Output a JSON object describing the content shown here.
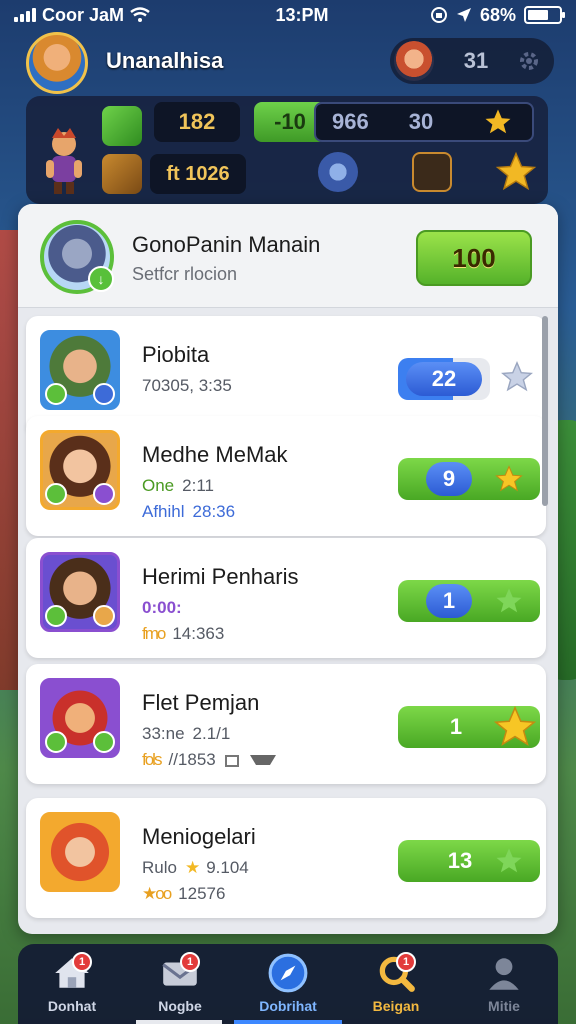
{
  "status_bar": {
    "carrier": "Coor JaM",
    "time": "13:PM",
    "battery": "68%",
    "battery_level": 0.68
  },
  "header": {
    "username": "Unanalhisa",
    "pill_value": "31"
  },
  "resources": {
    "r1": "182",
    "r2": "-10",
    "r3": "966",
    "r4": "30",
    "r5": "ft 1026"
  },
  "feature": {
    "title": "GonoPanin Manain",
    "subtitle": "Setfcr rlocion",
    "button_label": "100"
  },
  "items": [
    {
      "name": "Piobita",
      "line1": "70305, 3:35",
      "line2": "",
      "badge": "22",
      "star_style": "outline"
    },
    {
      "name": "Medhe MeMak",
      "line1_prefix": "One",
      "line1": "2:11",
      "line2_prefix": "Afhihl",
      "line2": "28:36",
      "badge": "9",
      "star_style": "gold"
    },
    {
      "name": "Herimi Penharis",
      "line1": "0:00:",
      "line2_prefix": "fmo",
      "line2": "14:363",
      "badge": "1",
      "star_style": "green"
    },
    {
      "name": "Flet Pemjan",
      "line1_prefix": "33:ne",
      "line1": "2.1/1",
      "line2_prefix": "fols",
      "line2": "//1853",
      "badge": "1",
      "star_style": "gold"
    },
    {
      "name": "Meniogelari",
      "line1_prefix": "Rulo",
      "line1": "9.104",
      "line2_prefix": "★oo",
      "line2": "12576",
      "badge": "13",
      "star_style": "green"
    }
  ],
  "nav": [
    {
      "label": "Donhat",
      "icon": "home-icon",
      "badge": "1"
    },
    {
      "label": "Nogbe",
      "icon": "mail-icon",
      "badge": "1"
    },
    {
      "label": "Dobrihat",
      "icon": "compass-icon",
      "badge": ""
    },
    {
      "label": "Beigan",
      "icon": "search-icon",
      "badge": "1"
    },
    {
      "label": "Mitie",
      "icon": "profile-icon",
      "badge": ""
    }
  ],
  "colors": {
    "accent_green": "#5cbf3a",
    "accent_blue": "#3c7ff0",
    "gold": "#f2b824",
    "nav_bg": "#141c34"
  }
}
